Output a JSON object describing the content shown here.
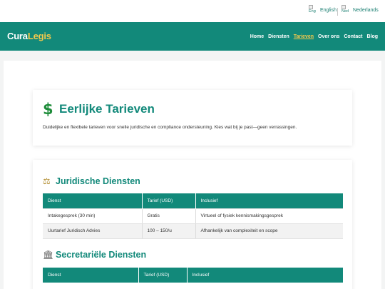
{
  "languages": [
    {
      "flag_alt": "Eng",
      "label": "English"
    },
    {
      "flag_alt": "Ned",
      "label": "Nederlands"
    }
  ],
  "brand": {
    "part1": "Cura",
    "part2": "Legis"
  },
  "nav": {
    "items": [
      "Home",
      "Diensten",
      "Tarieven",
      "Over ons",
      "Contact",
      "Blog"
    ],
    "active": "Tarieven"
  },
  "intro_card": {
    "icon": "dollar-icon",
    "title": "Eerlijke Tarieven",
    "text": "Duidelijke en flexibele tarieven voor snelle juridische en compliance ondersteuning. Kies wat bij je past—geen verrassingen."
  },
  "legal": {
    "icon": "scales-icon",
    "title": "Juridische Diensten",
    "headers": [
      "Dienst",
      "Tarief (USD)",
      "Inclusief"
    ],
    "rows": [
      [
        "Intakegesprek (30 min)",
        "Gratis",
        "Virtueel of fysiek kennismakingsgesprek"
      ],
      [
        "Uurtarief Juridisch Advies",
        "100 – 150/u",
        "Afhankelijk van complexiteit en scope"
      ]
    ]
  },
  "secretarial": {
    "icon": "bank-building-icon",
    "title": "Secretariële Diensten",
    "headers": [
      "Dienst",
      "Tarief (USD)",
      "Inclusief"
    ]
  },
  "colors": {
    "primary": "#12897a",
    "accent": "#f2c94c",
    "dollar": "#1e8c3a"
  }
}
